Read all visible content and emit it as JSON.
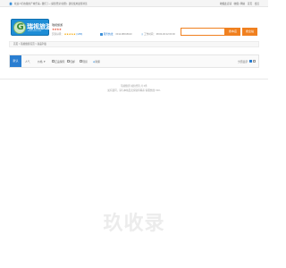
{
  "topbar": {
    "welcome": "欢迎人们在我的产城乐来~ 我们了~ [请您登录/注册] · 建议使用最佳浏览",
    "links": [
      "收藏此店铺",
      "收藏 | 网站",
      "首页",
      "会员"
    ]
  },
  "logo": {
    "text": "瑞视旅游",
    "sub": "www.ruishi.com",
    "glyph": "G"
  },
  "shop": {
    "name": "瑞视旅游",
    "stars": "★★★★",
    "meta_label": "买家好评：",
    "meta_stars": "★★★★★",
    "meta_count": "(1/89)",
    "service_label": "服务热线：",
    "service_value": "0314-88016610",
    "phone_label": "工作时间：",
    "phone_value": "08:00-00:22:00:00"
  },
  "search": {
    "placeholder": "",
    "store_button": "搜本店",
    "all_button": "搜全站"
  },
  "breadcrumb": {
    "text": "首页 > 瑞视旅游首页 > 商品列表"
  },
  "filters": {
    "default_tab": "默认",
    "tabs": [
      "人气",
      "价格 ▼"
    ],
    "checks": [
      "正品保障",
      "包邮",
      "现货",
      "消保"
    ],
    "view_label": "分页显示:"
  },
  "footer": {
    "line1": "瑞视旅游 诚信经营 共 0条",
    "line2": "如有疑问，请与本站及卖家取得联系 客服热线: 010-"
  },
  "watermark": "玖收录",
  "colors": {
    "accent_orange": "#f0801f",
    "brand_blue": "#2a7ed1",
    "star_red": "#e8492f"
  }
}
